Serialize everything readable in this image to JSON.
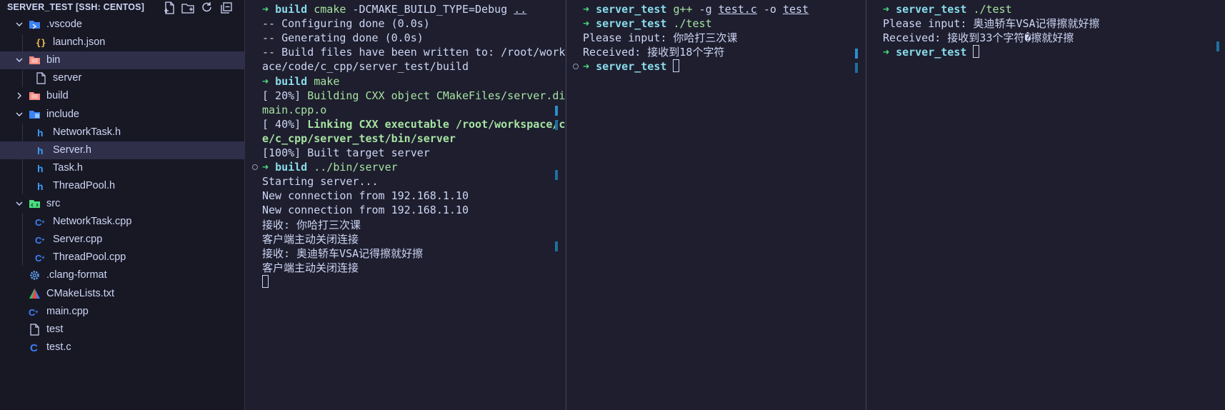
{
  "explorer": {
    "title": "SERVER_TEST [SSH: CENTOS]",
    "actions": [
      {
        "name": "new-file-icon"
      },
      {
        "name": "new-folder-icon"
      },
      {
        "name": "refresh-icon"
      },
      {
        "name": "collapse-all-icon"
      }
    ],
    "tree": [
      {
        "label": ".vscode",
        "type": "folder",
        "icon": "vscode-folder-icon",
        "expanded": true
      },
      {
        "label": "launch.json",
        "type": "file",
        "icon": "json-file-icon"
      },
      {
        "label": "bin",
        "type": "folder",
        "icon": "bin-folder-icon",
        "expanded": true
      },
      {
        "label": "server",
        "type": "file",
        "icon": "file-icon"
      },
      {
        "label": "build",
        "type": "folder",
        "icon": "build-folder-icon",
        "expanded": false
      },
      {
        "label": "include",
        "type": "folder",
        "icon": "include-folder-icon",
        "expanded": true
      },
      {
        "label": "NetworkTask.h",
        "type": "file",
        "icon": "header-file-icon"
      },
      {
        "label": "Server.h",
        "type": "file",
        "icon": "header-file-icon"
      },
      {
        "label": "Task.h",
        "type": "file",
        "icon": "header-file-icon"
      },
      {
        "label": "ThreadPool.h",
        "type": "file",
        "icon": "header-file-icon"
      },
      {
        "label": "src",
        "type": "folder",
        "icon": "src-folder-icon",
        "expanded": true
      },
      {
        "label": "NetworkTask.cpp",
        "type": "file",
        "icon": "cpp-file-icon"
      },
      {
        "label": "Server.cpp",
        "type": "file",
        "icon": "cpp-file-icon"
      },
      {
        "label": "ThreadPool.cpp",
        "type": "file",
        "icon": "cpp-file-icon"
      },
      {
        "label": ".clang-format",
        "type": "file",
        "icon": "gear-icon"
      },
      {
        "label": "CMakeLists.txt",
        "type": "file",
        "icon": "cmake-icon"
      },
      {
        "label": "main.cpp",
        "type": "file",
        "icon": "cpp-file-icon"
      },
      {
        "label": "test",
        "type": "file",
        "icon": "file-icon"
      },
      {
        "label": "test.c",
        "type": "file",
        "icon": "c-file-icon"
      }
    ],
    "selected": [
      "bin",
      "Server.h"
    ]
  },
  "terminal1": {
    "lines": [
      {
        "kind": "prompt",
        "dir": "build",
        "cmd": "cmake",
        "rest": " -DCMAKE_BUILD_TYPE=Debug ",
        "arg_u": ".."
      },
      {
        "kind": "text",
        "text": "-- Configuring done (0.0s)"
      },
      {
        "kind": "text",
        "text": "-- Generating done (0.0s)"
      },
      {
        "kind": "text",
        "text": "-- Build files have been written to: /root/worksp"
      },
      {
        "kind": "text",
        "text": "ace/code/c_cpp/server_test/build"
      },
      {
        "kind": "prompt",
        "dir": "build",
        "cmd": "make"
      },
      {
        "kind": "progress",
        "pct": "[ 20%] ",
        "msg": "Building CXX object CMakeFiles/server.dir/"
      },
      {
        "kind": "green",
        "text": "main.cpp.o"
      },
      {
        "kind": "progress-bold",
        "pct": "[ 40%] ",
        "msg": "Linking CXX executable /root/workspace/cod"
      },
      {
        "kind": "greenbold",
        "text": "e/c_cpp/server_test/bin/server"
      },
      {
        "kind": "text",
        "text": "[100%] Built target server"
      },
      {
        "kind": "prompt",
        "dir": "build",
        "cmd": "../bin/server",
        "dot": true
      },
      {
        "kind": "text",
        "text": "Starting server..."
      },
      {
        "kind": "text",
        "text": "New connection from 192.168.1.10"
      },
      {
        "kind": "text",
        "text": "New connection from 192.168.1.10"
      },
      {
        "kind": "text",
        "text": "接收: 你哈打三次课"
      },
      {
        "kind": "text",
        "text": "客户端主动关闭连接"
      },
      {
        "kind": "text",
        "text": "接收: 奥迪轿车VSA记得擦就好擦"
      },
      {
        "kind": "text",
        "text": "客户端主动关闭连接"
      },
      {
        "kind": "cursor"
      }
    ]
  },
  "terminal2": {
    "lines": [
      {
        "kind": "prompt",
        "dir": "server_test",
        "cmd": "g++",
        "rest": " -g ",
        "arg_u": "test.c",
        "rest2": " -o ",
        "arg_u2": "test"
      },
      {
        "kind": "prompt",
        "dir": "server_test",
        "cmd": "./test"
      },
      {
        "kind": "text",
        "text": "Please input: 你哈打三次课"
      },
      {
        "kind": "text",
        "text": "Received: 接收到18个字符"
      },
      {
        "kind": "prompt-cursor",
        "dir": "server_test",
        "dot": true
      }
    ]
  },
  "terminal3": {
    "lines": [
      {
        "kind": "prompt",
        "dir": "server_test",
        "cmd": "./test"
      },
      {
        "kind": "text",
        "text": "Please input: 奥迪轿车VSA记得擦就好擦"
      },
      {
        "kind": "text",
        "text": "Received: 接收到33个字符�擦就好擦"
      },
      {
        "kind": "prompt-cursor",
        "dir": "server_test"
      }
    ]
  },
  "prompt_arrow": "➜",
  "colors": {
    "background": "#1e1e2e",
    "sidebar": "#181825",
    "arrow": "#4ade80",
    "dir": "#89dceb",
    "command": "#a6e3a1",
    "text": "#cdd6f4",
    "selection": "#2f2f4a"
  }
}
